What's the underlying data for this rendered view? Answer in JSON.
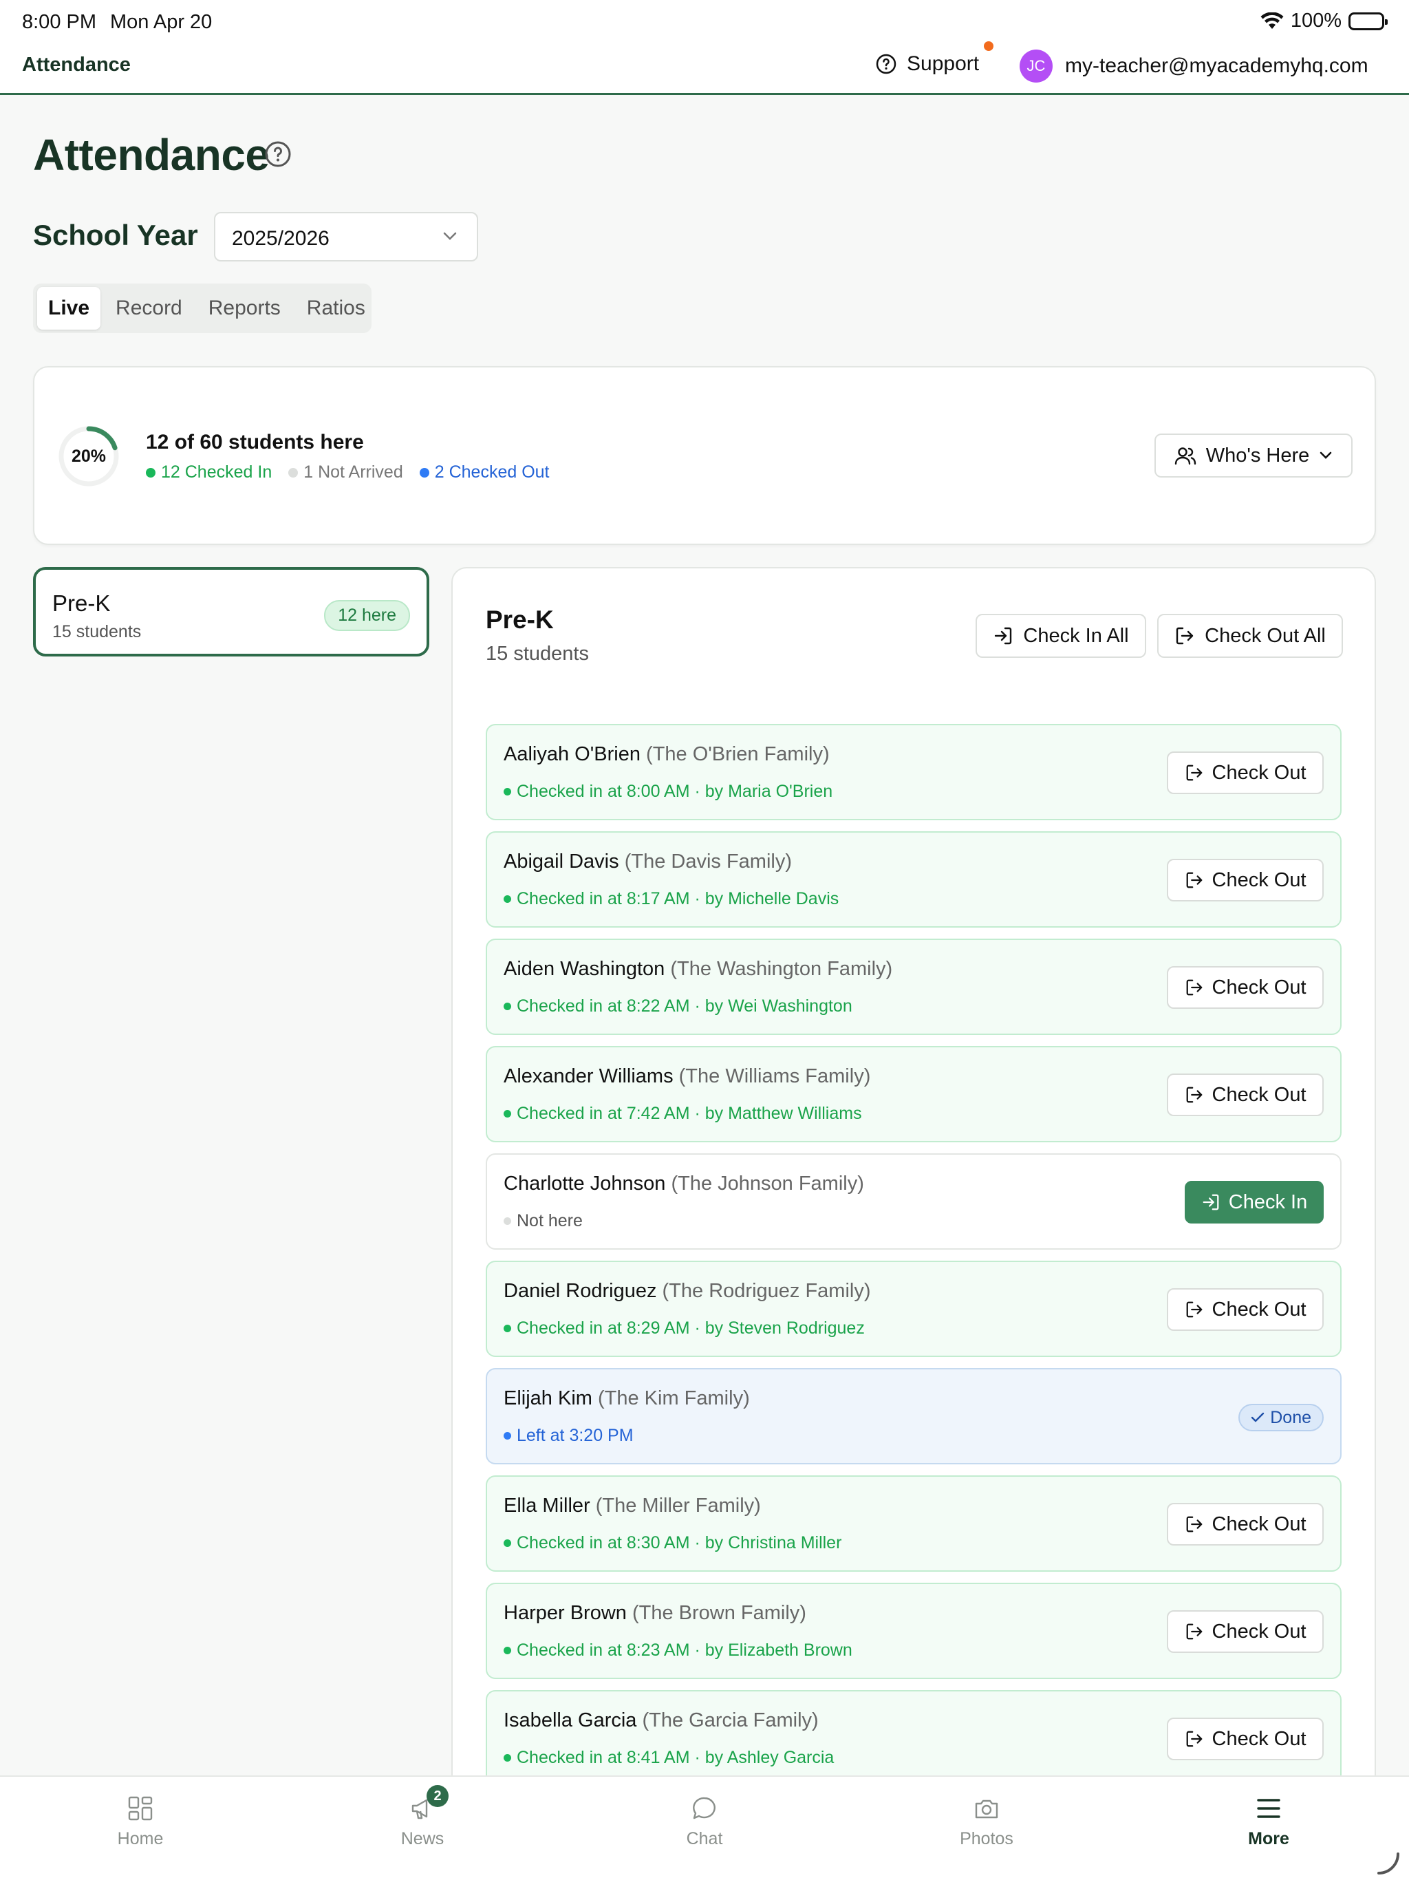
{
  "status_bar": {
    "time": "8:00 PM",
    "date": "Mon Apr 20",
    "battery": "100%"
  },
  "header": {
    "app_title": "Attendance",
    "support_label": "Support",
    "user_initials": "JC",
    "user_email": "my-teacher@myacademyhq.com"
  },
  "page": {
    "title": "Attendance",
    "school_year_label": "School Year",
    "school_year_value": "2025/2026",
    "tabs": [
      "Live",
      "Record",
      "Reports",
      "Ratios"
    ],
    "active_tab": "Live"
  },
  "summary": {
    "percent_label": "20%",
    "percent": 20,
    "headline": "12 of 60 students here",
    "checked_in": "12 Checked In",
    "not_arrived": "1 Not Arrived",
    "checked_out": "2 Checked Out",
    "whos_here_label": "Who's Here"
  },
  "class_card": {
    "name": "Pre-K",
    "count": "15 students",
    "badge": "12 here"
  },
  "panel": {
    "title": "Pre-K",
    "subtitle": "15 students",
    "check_in_all": "Check In All",
    "check_out_all": "Check Out All"
  },
  "students": [
    {
      "name": "Aaliyah O'Brien",
      "family": "(The O'Brien Family)",
      "status": "Checked in at 8:00 AM · by Maria O'Brien",
      "state": "in",
      "action": "Check Out"
    },
    {
      "name": "Abigail Davis",
      "family": "(The Davis Family)",
      "status": "Checked in at 8:17 AM · by Michelle Davis",
      "state": "in",
      "action": "Check Out"
    },
    {
      "name": "Aiden Washington",
      "family": "(The Washington Family)",
      "status": "Checked in at 8:22 AM · by Wei Washington",
      "state": "in",
      "action": "Check Out"
    },
    {
      "name": "Alexander Williams",
      "family": "(The Williams Family)",
      "status": "Checked in at 7:42 AM · by Matthew Williams",
      "state": "in",
      "action": "Check Out"
    },
    {
      "name": "Charlotte Johnson",
      "family": "(The Johnson Family)",
      "status": "Not here",
      "state": "not-here",
      "action": "Check In"
    },
    {
      "name": "Daniel Rodriguez",
      "family": "(The Rodriguez Family)",
      "status": "Checked in at 8:29 AM · by Steven Rodriguez",
      "state": "in",
      "action": "Check Out"
    },
    {
      "name": "Elijah Kim",
      "family": "(The Kim Family)",
      "status": "Left at 3:20 PM",
      "state": "done",
      "action": "Done"
    },
    {
      "name": "Ella Miller",
      "family": "(The Miller Family)",
      "status": "Checked in at 8:30 AM · by Christina Miller",
      "state": "in",
      "action": "Check Out"
    },
    {
      "name": "Harper Brown",
      "family": "(The Brown Family)",
      "status": "Checked in at 8:23 AM · by Elizabeth Brown",
      "state": "in",
      "action": "Check Out"
    },
    {
      "name": "Isabella Garcia",
      "family": "(The Garcia Family)",
      "status": "Checked in at 8:41 AM · by Ashley Garcia",
      "state": "in",
      "action": "Check Out"
    }
  ],
  "tabbar": {
    "items": [
      {
        "label": "Home",
        "icon": "grid-icon"
      },
      {
        "label": "News",
        "icon": "megaphone-icon",
        "badge": "2"
      },
      {
        "label": "Chat",
        "icon": "chat-bubble-icon"
      },
      {
        "label": "Photos",
        "icon": "camera-icon"
      },
      {
        "label": "More",
        "icon": "menu-icon",
        "active": true
      }
    ]
  },
  "colors": {
    "brand": "#2e6b4a",
    "checked_in": "#1aa34a",
    "not_arrived": "#d9dcd9",
    "checked_out": "#2f7bf5",
    "avatar": "#b44ef5",
    "notification": "#f26b1d"
  }
}
